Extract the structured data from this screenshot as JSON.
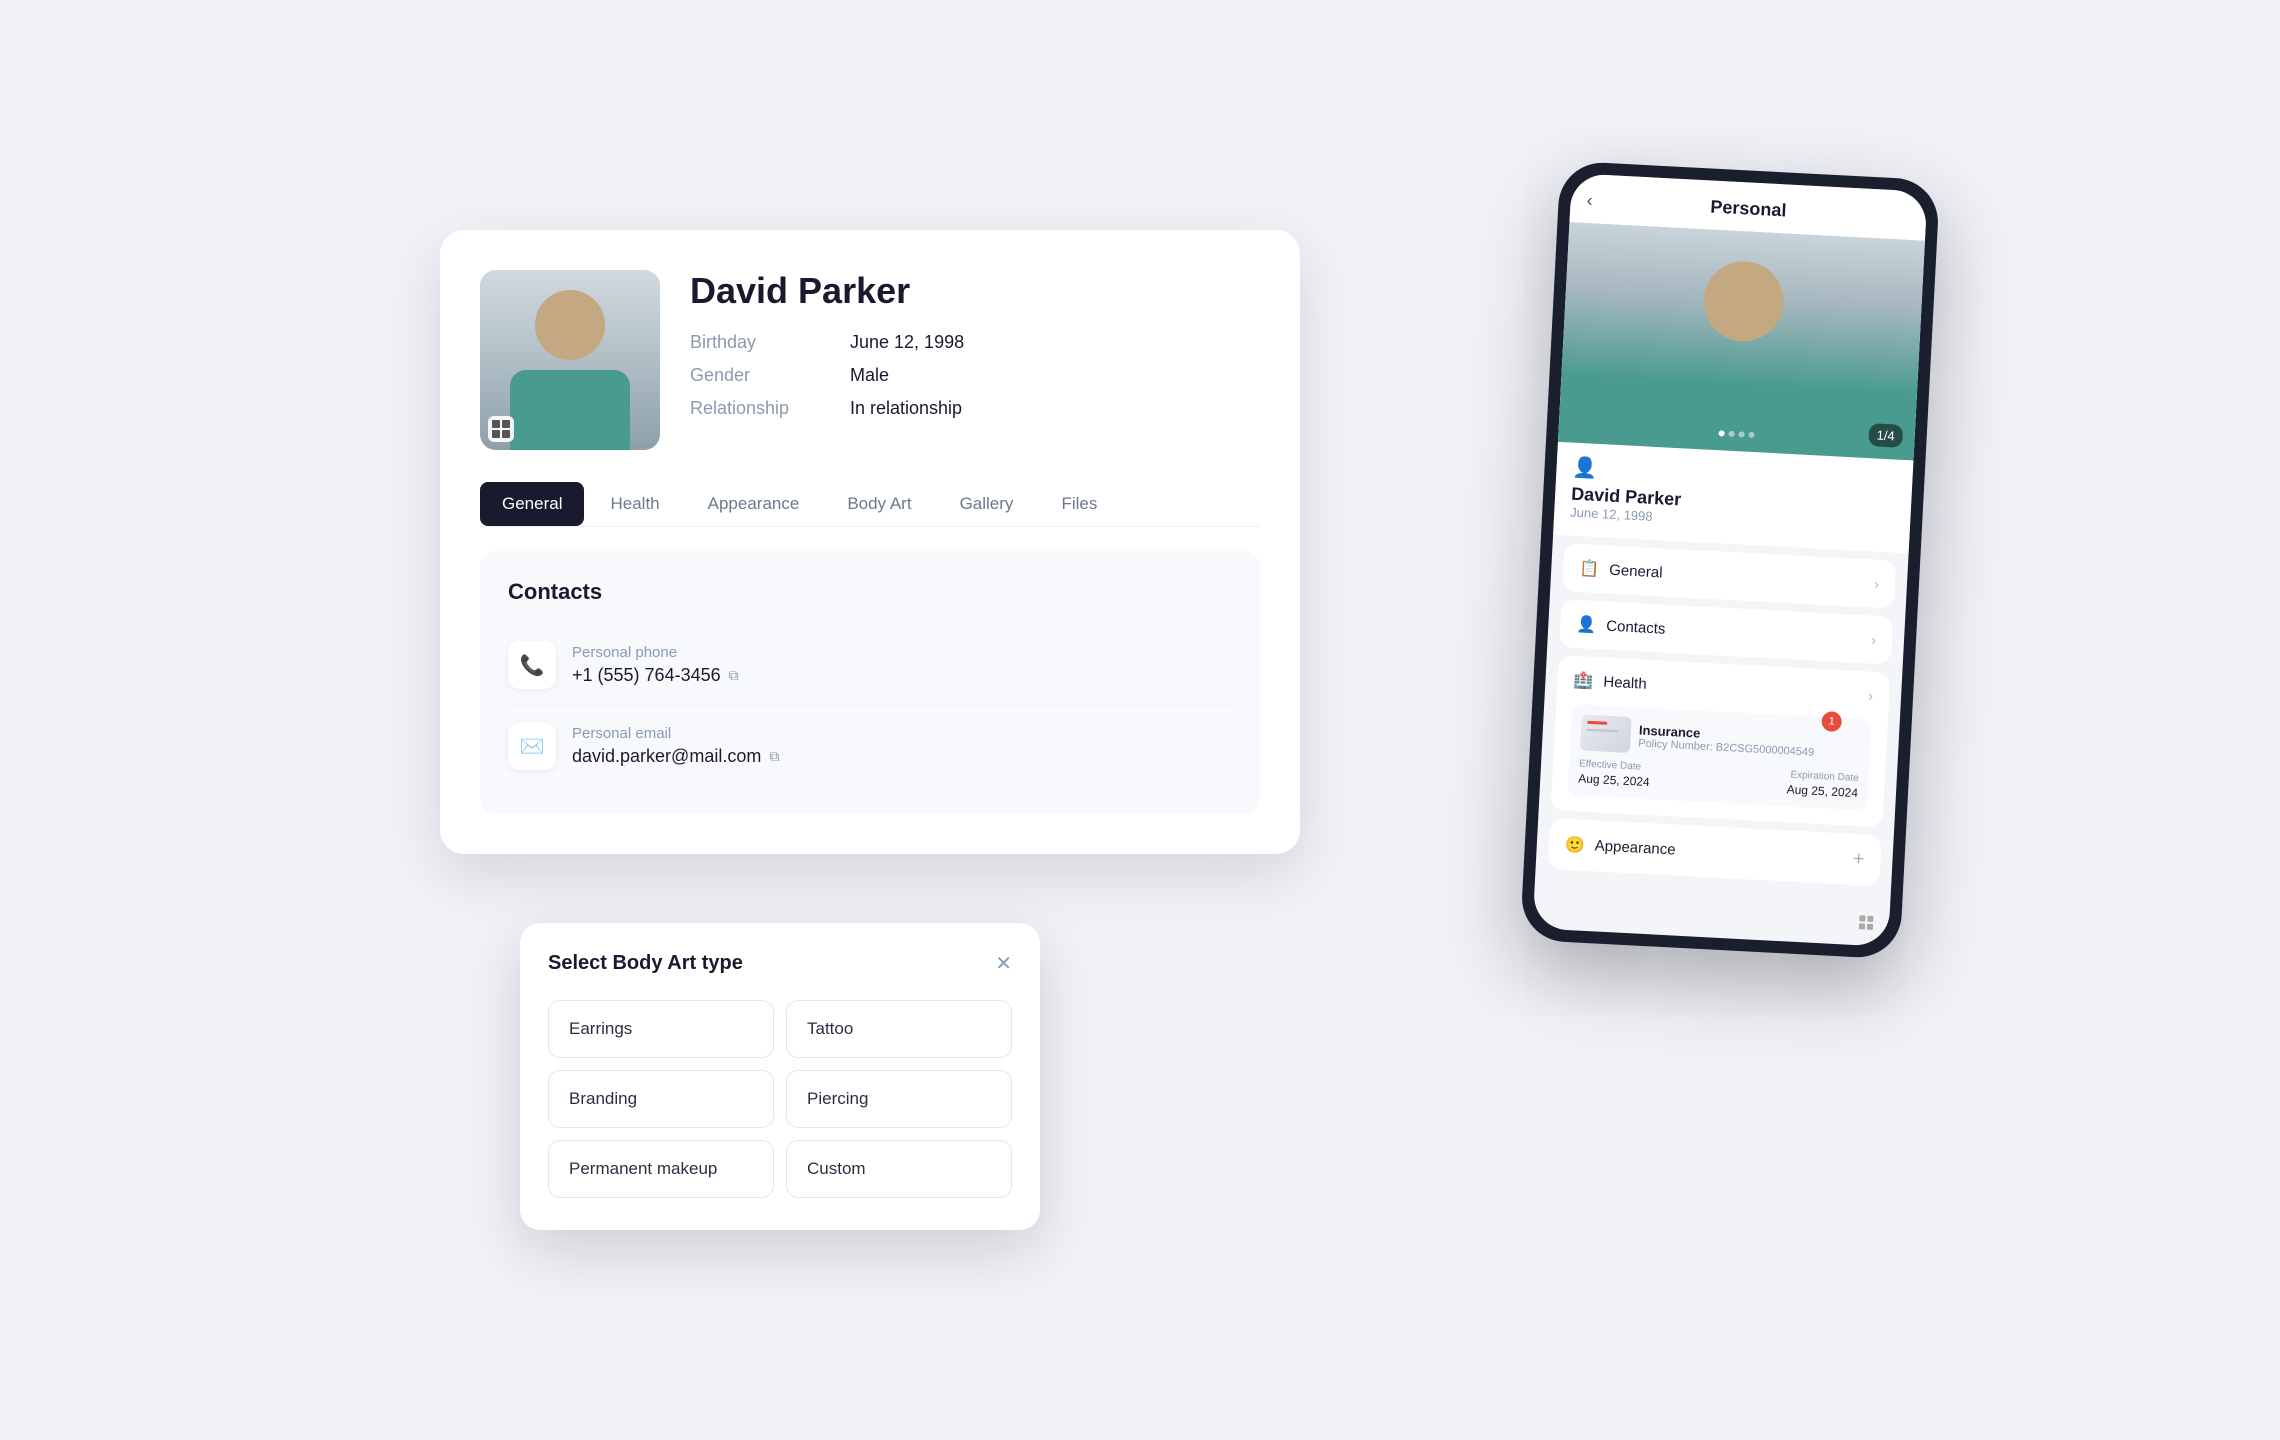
{
  "desktop": {
    "profile": {
      "name": "David Parker",
      "birthday_label": "Birthday",
      "birthday_value": "June 12, 1998",
      "gender_label": "Gender",
      "gender_value": "Male",
      "relationship_label": "Relationship",
      "relationship_value": "In relationship"
    },
    "tabs": [
      {
        "label": "General",
        "active": true
      },
      {
        "label": "Health",
        "active": false
      },
      {
        "label": "Appearance",
        "active": false
      },
      {
        "label": "Body Art",
        "active": false
      },
      {
        "label": "Gallery",
        "active": false
      },
      {
        "label": "Files",
        "active": false
      }
    ],
    "contacts": {
      "section_title": "Contacts",
      "items": [
        {
          "type": "Personal phone",
          "value": "+1 (555) 764-3456",
          "icon": "📞"
        },
        {
          "type": "Personal email",
          "value": "david.parker@mail.com",
          "icon": "✉️"
        }
      ]
    },
    "body_art_dropdown": {
      "title": "Select Body Art type",
      "options": [
        "Earrings",
        "Tattoo",
        "Branding",
        "Piercing",
        "Permanent makeup",
        "Custom"
      ]
    }
  },
  "mobile": {
    "header_title": "Personal",
    "back_icon": "‹",
    "photo_counter": "1/4",
    "photo_dots": 4,
    "profile_name": "David Parker",
    "profile_date": "June 12, 1998",
    "sections": [
      {
        "icon": "📋",
        "label": "General",
        "has_chevron": true
      },
      {
        "icon": "👤",
        "label": "Contacts",
        "has_chevron": true
      },
      {
        "icon": "🏥",
        "label": "Health",
        "has_chevron": true
      }
    ],
    "insurance": {
      "name": "Insurance",
      "policy_label": "Policy Number:",
      "policy_value": "B2CSG5000004549",
      "effective_label": "Effective Date",
      "effective_value": "Aug 25, 2024",
      "expiration_label": "Expiration Date",
      "expiration_value": "Aug 25, 2024",
      "badge": "1"
    },
    "appearance": {
      "label": "Appearance",
      "icon": "🙂"
    }
  }
}
